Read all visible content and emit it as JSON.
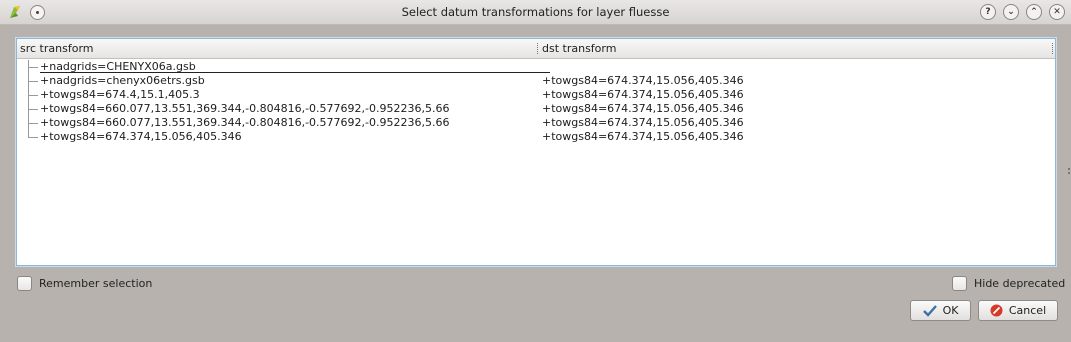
{
  "window": {
    "title": "Select datum transformations for layer fluesse",
    "buttons": {
      "help": "?",
      "minimize": "⌄",
      "maximize": "⌃",
      "close": "✕"
    }
  },
  "table": {
    "columns": [
      "src transform",
      "dst transform"
    ],
    "rows": [
      {
        "src": "+nadgrids=CHENYX06a.gsb",
        "dst": ""
      },
      {
        "src": "+nadgrids=chenyx06etrs.gsb",
        "dst": "+towgs84=674.374,15.056,405.346"
      },
      {
        "src": "+towgs84=674.4,15.1,405.3",
        "dst": "+towgs84=674.374,15.056,405.346"
      },
      {
        "src": "+towgs84=660.077,13.551,369.344,-0.804816,-0.577692,-0.952236,5.66",
        "dst": "+towgs84=674.374,15.056,405.346"
      },
      {
        "src": "+towgs84=660.077,13.551,369.344,-0.804816,-0.577692,-0.952236,5.66",
        "dst": "+towgs84=674.374,15.056,405.346"
      },
      {
        "src": "+towgs84=674.374,15.056,405.346",
        "dst": "+towgs84=674.374,15.056,405.346"
      }
    ]
  },
  "options": {
    "remember_label": "Remember selection",
    "hide_deprecated_label": "Hide deprecated"
  },
  "actions": {
    "ok_label": "OK",
    "cancel_label": "Cancel"
  },
  "colors": {
    "accent": "#8fb6d6",
    "ok_check": "#3d6fa8",
    "cancel_red": "#d83a2a"
  }
}
